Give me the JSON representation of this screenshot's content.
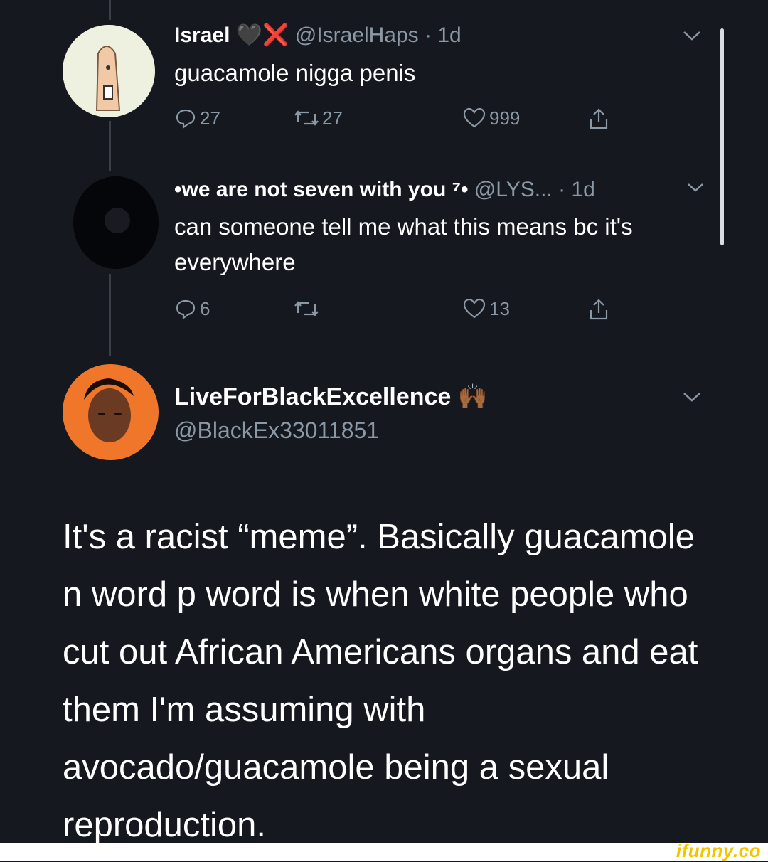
{
  "tweet1": {
    "name": "Israel",
    "emoji": "🖤❌",
    "handle": "@IsraelHaps",
    "time": "· 1d",
    "text": "guacamole nigga penis",
    "replies": "27",
    "retweets": "27",
    "likes": "999"
  },
  "tweet2": {
    "name": "•we are not seven with you ⁷•",
    "handle": "@LYS...",
    "time": "· 1d",
    "text": "can someone tell me what this means bc it's everywhere",
    "replies": "6",
    "retweets": "",
    "likes": "13"
  },
  "tweet3": {
    "name": "LiveForBlackExcellence",
    "emoji": "🙌🏾",
    "handle": "@BlackEx33011851",
    "text": "It's a racist “meme”. Basically guacamole n word p word is when white people who cut out African Americans organs and eat them I'm assuming with avocado/guacamole being a sexual reproduction."
  },
  "watermark": "ifunny.co",
  "colors": {
    "background": "#15181e",
    "muted": "#8b98a5",
    "watermark": "#f4c400"
  },
  "icons": [
    "reply-icon",
    "retweet-icon",
    "like-icon",
    "share-icon",
    "chevron-down-icon"
  ]
}
